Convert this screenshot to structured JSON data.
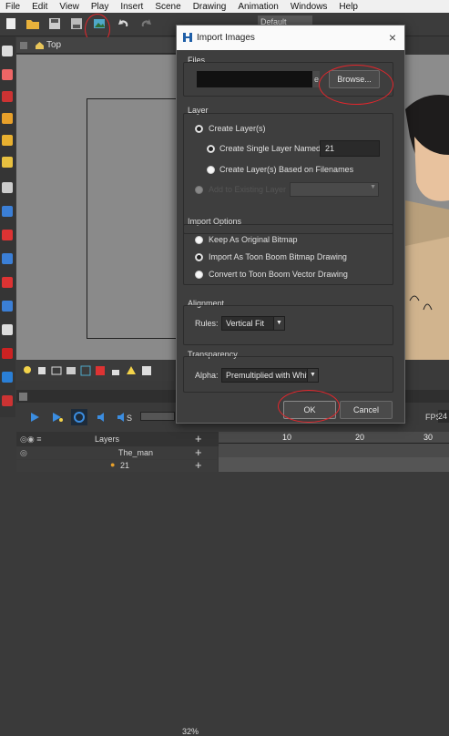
{
  "menu": [
    "File",
    "Edit",
    "View",
    "Play",
    "Insert",
    "Scene",
    "Drawing",
    "Animation",
    "Windows",
    "Help"
  ],
  "toolbar": {
    "workspace_select": "Default",
    "icons": [
      "new-icon",
      "open-icon",
      "save-icon",
      "import-images-icon",
      "undo-icon",
      "redo-icon"
    ]
  },
  "camera_view": {
    "tab_label": "Top",
    "zoom": "32%"
  },
  "dialog": {
    "title": "Import Images",
    "close": "×",
    "files": {
      "label": "Files",
      "path_fragment": "e",
      "browse_button": "Browse..."
    },
    "layer": {
      "label": "Layer",
      "create_layers": "Create Layer(s)",
      "create_single_named": "Create Single Layer Named:",
      "single_layer_name": "21",
      "create_by_filenames": "Create Layer(s) Based on Filenames",
      "add_to_existing": "Add to Existing Layer"
    },
    "import_options": {
      "label": "Import Options",
      "keep_bitmap": "Keep As Original Bitmap",
      "toon_boom_bitmap": "Import As Toon Boom Bitmap Drawing",
      "toon_boom_vector": "Convert to Toon Boom Vector Drawing"
    },
    "alignment": {
      "label": "Alignment",
      "rules_label": "Rules:",
      "rules_value": "Vertical Fit"
    },
    "transparency": {
      "label": "Transparency",
      "alpha_label": "Alpha:",
      "alpha_value": "Premultiplied with White"
    },
    "ok_button": "OK",
    "cancel_button": "Cancel"
  },
  "timeline": {
    "fps_label": "FPS",
    "fps_value": "24",
    "layers_header": "Layers",
    "rows": [
      "The_man",
      "21"
    ],
    "ruler": [
      "10",
      "20",
      "30"
    ]
  },
  "colors": {
    "annotation_red": "#e4262c",
    "dialog_bg": "#3e3e3e",
    "accent_blue": "#2b8be6"
  }
}
